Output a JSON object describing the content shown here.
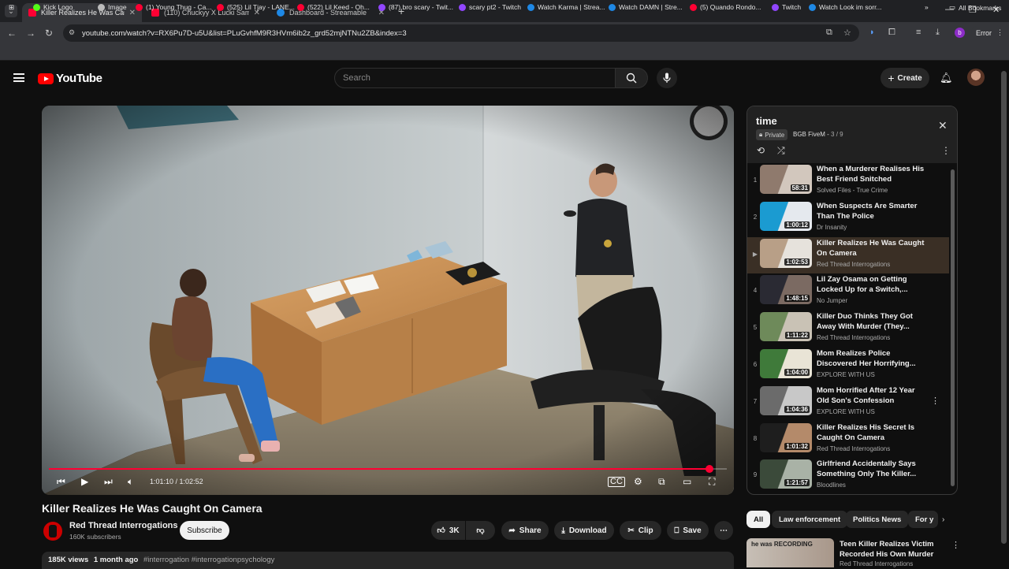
{
  "browser": {
    "tabs": [
      {
        "title": "Killer Realizes He Was Caught O",
        "favicon_color": "#ff0033",
        "active": true
      },
      {
        "title": "(110) Chuckyy X Lucki Sample",
        "favicon_color": "#ff0033",
        "active": false
      },
      {
        "title": "Dashboard - Streamable",
        "favicon_color": "#1e88e5",
        "active": false
      }
    ],
    "url": "youtube.com/watch?v=RX6Pu7D-u5U&list=PLuGvhfM9R3HVm6ib2z_grd52mjNTNu2ZB&index=3",
    "profile_initial": "b",
    "error_label": "Error",
    "bookmarks": [
      {
        "label": "Kick Logo",
        "color": "#53fc18"
      },
      {
        "label": "Image",
        "color": "#bbbbbb"
      },
      {
        "label": "(1) Young Thug - Ca...",
        "color": "#ff0033"
      },
      {
        "label": "(525) Lil Tjay - LANE...",
        "color": "#ff0033"
      },
      {
        "label": "(522) Lil Keed - Oh...",
        "color": "#ff0033"
      },
      {
        "label": "(87) bro scary - Twit...",
        "color": "#9146ff"
      },
      {
        "label": "scary pt2 - Twitch",
        "color": "#9146ff"
      },
      {
        "label": "Watch Karma | Strea...",
        "color": "#1e88e5"
      },
      {
        "label": "Watch DAMN | Stre...",
        "color": "#1e88e5"
      },
      {
        "label": "(5) Quando Rondo...",
        "color": "#ff0033"
      },
      {
        "label": "Twitch",
        "color": "#9146ff"
      },
      {
        "label": "Watch Look im sorr...",
        "color": "#1e88e5"
      }
    ],
    "all_bookmarks": "All Bookmarks"
  },
  "header": {
    "logo": "YouTube",
    "search_placeholder": "Search",
    "create_label": "Create"
  },
  "player": {
    "progress": 0.9745,
    "current_time": "1:01:10",
    "duration": "1:02:52",
    "time_separator": " / "
  },
  "video": {
    "title": "Killer Realizes He Was Caught On Camera",
    "channel": "Red Thread Interrogations",
    "subscribers": "160K subscribers",
    "subscribe_label": "Subscribe",
    "likes": "3K",
    "share_label": "Share",
    "download_label": "Download",
    "clip_label": "Clip",
    "save_label": "Save",
    "views": "185K views",
    "age": "1 month ago",
    "hashtags": "#interrogation #interrogationpsychology"
  },
  "playlist": {
    "title": "time",
    "privacy": "Private",
    "owner": "BGB FiveM",
    "position": "3 / 9",
    "items": [
      {
        "num": "1",
        "title": "When a Murderer Realises His Best Friend Snitched",
        "channel": "Solved Files - True Crime",
        "duration": "58:31",
        "c1": "#8f7a6d",
        "c2": "#d2c7bd"
      },
      {
        "num": "2",
        "title": "When Suspects Are Smarter Than The Police",
        "channel": "Dr Insanity",
        "duration": "1:00:12",
        "c1": "#1b9bd1",
        "c2": "#e5e9ee"
      },
      {
        "num": "▶",
        "title": "Killer Realizes He Was Caught On Camera",
        "channel": "Red Thread Interrogations",
        "duration": "1:02:53",
        "c1": "#b89f87",
        "c2": "#e6e2dc",
        "active": true
      },
      {
        "num": "4",
        "title": "Lil Zay Osama on Getting Locked Up for a Switch,...",
        "channel": "No Jumper",
        "duration": "1:48:15",
        "c1": "#2a2a33",
        "c2": "#7b6a62"
      },
      {
        "num": "5",
        "title": "Killer Duo Thinks They Got Away With Murder (They...",
        "channel": "Red Thread Interrogations",
        "duration": "1:11:22",
        "c1": "#6e8a5a",
        "c2": "#c9c2b5"
      },
      {
        "num": "6",
        "title": "Mom Realizes Police Discovered Her Horrifying...",
        "channel": "EXPLORE WITH US",
        "duration": "1:04:00",
        "c1": "#3f7a3a",
        "c2": "#e9e4d6"
      },
      {
        "num": "7",
        "title": "Mom Horrified After 12 Year Old Son's Confession",
        "channel": "EXPLORE WITH US",
        "duration": "1:04:36",
        "c1": "#6b6b6b",
        "c2": "#c8c8c8"
      },
      {
        "num": "8",
        "title": "Killer Realizes His Secret Is Caught On Camera",
        "channel": "Red Thread Interrogations",
        "duration": "1:01:32",
        "c1": "#1e1e1e",
        "c2": "#b48a6a"
      },
      {
        "num": "9",
        "title": "Girlfriend Accidentally Says Something Only The Killer...",
        "channel": "Bloodlines",
        "duration": "1:21:57",
        "c1": "#3b4a3a",
        "c2": "#a9b2a6"
      }
    ]
  },
  "chips": [
    "All",
    "Law enforcement",
    "Politics News",
    "For y"
  ],
  "recommendation": {
    "title": "Teen Killer Realizes Victim Recorded His Own Murder",
    "channel": "Red Thread Interrogations",
    "thumb_text": "he was RECORDING"
  }
}
